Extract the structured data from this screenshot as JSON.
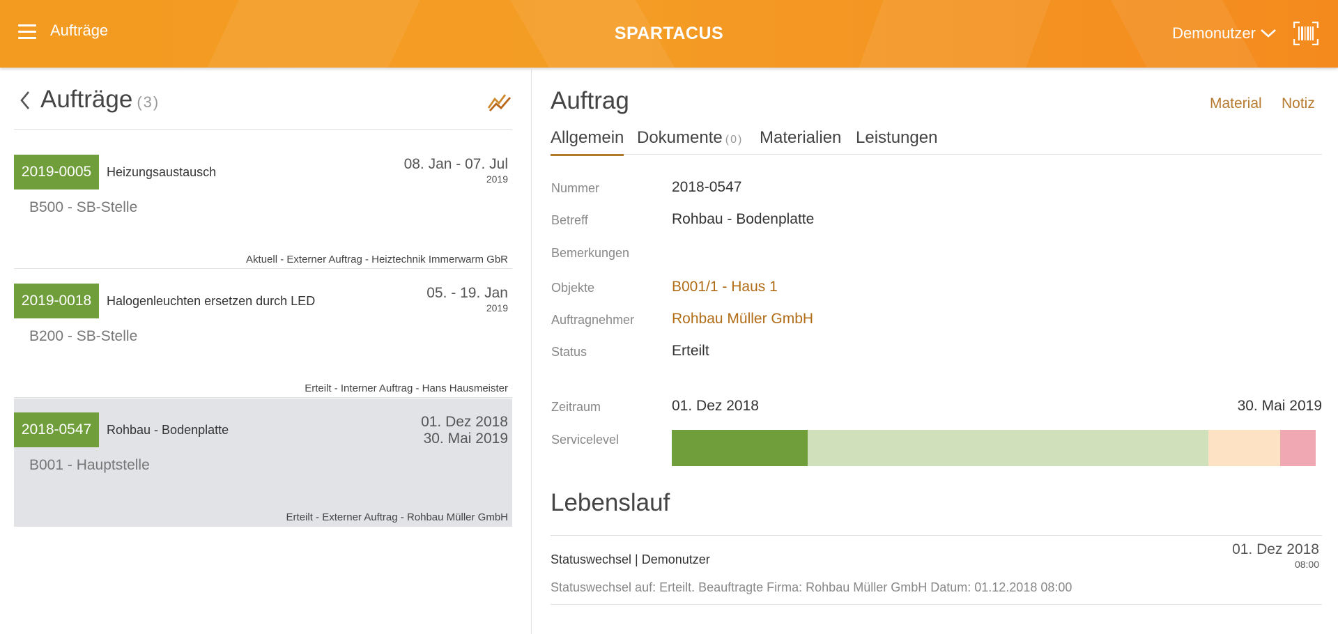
{
  "topbar": {
    "menu_title": "Aufträge",
    "brand": "SPARTACUS",
    "user": "Demonutzer",
    "accent_color": "#f39a20"
  },
  "list": {
    "title": "Aufträge",
    "count": "(3)",
    "orders": [
      {
        "number": "2019-0005",
        "subject": "Heizungsaustausch",
        "date": "08. Jan - 07. Jul",
        "year": "2019",
        "location": "B500 - SB-Stelle",
        "meta": "Aktuell - Externer Auftrag - Heiztechnik Immerwarm GbR"
      },
      {
        "number": "2019-0018",
        "subject": "Halogenleuchten ersetzen durch LED",
        "date": "05. - 19. Jan",
        "year": "2019",
        "location": "B200 - SB-Stelle",
        "meta": "Erteilt - Interner Auftrag - Hans Hausmeister"
      },
      {
        "number": "2018-0547",
        "subject": "Rohbau - Bodenplatte",
        "date": "01. Dez 2018",
        "year": "30. Mai 2019",
        "location": "B001 - Hauptstelle",
        "meta": "Erteilt - Externer Auftrag - Rohbau Müller GmbH"
      }
    ]
  },
  "detail": {
    "title": "Auftrag",
    "links": {
      "material": "Material",
      "notiz": "Notiz"
    },
    "tabs": {
      "allgemein": "Allgemein",
      "dokumente": "Dokumente",
      "dokumente_count": "(0)",
      "materialien": "Materialien",
      "leistungen": "Leistungen"
    },
    "fields": {
      "nummer_label": "Nummer",
      "nummer": "2018-0547",
      "betreff_label": "Betreff",
      "betreff": "Rohbau - Bodenplatte",
      "bemerkungen_label": "Bemerkungen",
      "objekte_label": "Objekte",
      "objekte": "B001/1 - Haus 1",
      "auftragnehmer_label": "Auftragnehmer",
      "auftragnehmer": "Rohbau Müller GmbH",
      "status_label": "Status",
      "status": "Erteilt",
      "zeitraum_label": "Zeitraum",
      "zeitraum_start": "01. Dez 2018",
      "zeitraum_end": "30. Mai 2019",
      "servicelevel_label": "Servicelevel"
    },
    "servicelevel": {
      "segments": [
        {
          "fraction": 0.211,
          "color": "#6f9e3b"
        },
        {
          "fraction": 0.622,
          "color": "#d0e0bb"
        },
        {
          "fraction": 0.111,
          "color": "#fde3c3"
        },
        {
          "fraction": 0.056,
          "color": "#f0a9b3"
        }
      ]
    },
    "lebenslauf": {
      "title": "Lebenslauf",
      "entry": {
        "head": "Statuswechsel | Demonutzer",
        "date": "01. Dez 2018",
        "time": "08:00",
        "text": "Statuswechsel auf: Erteilt. Beauftragte Firma: Rohbau Müller GmbH Datum: 01.12.2018 08:00"
      }
    }
  }
}
